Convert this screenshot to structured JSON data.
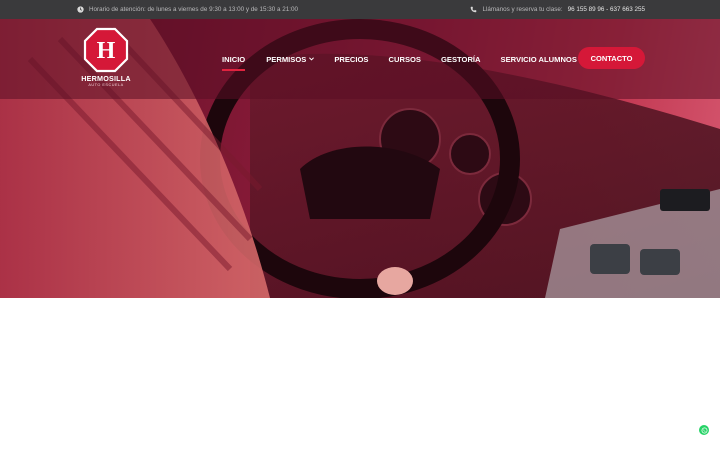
{
  "topbar": {
    "hours": "Horario de atención: de lunes a viernes de 9:30 a 13:00 y de 15:30 a 21:00",
    "call_prefix": "Llámanos y reserva tu clase:",
    "phones": "96 155 89 96 - 637 663 255",
    "icons": {
      "hours": "clock-icon",
      "call": "phone-icon"
    }
  },
  "logo": {
    "name": "HERMOSILLA",
    "subtitle": "AUTO ESCUELA",
    "monogram": "H"
  },
  "nav": {
    "items": [
      {
        "label": "INICIO",
        "active": true
      },
      {
        "label": "PERMISOS",
        "has_dropdown": true
      },
      {
        "label": "PRECIOS"
      },
      {
        "label": "CURSOS"
      },
      {
        "label": "GESTORÍA"
      },
      {
        "label": "SERVICIO ALUMNOS"
      }
    ],
    "cta": "CONTACTO"
  },
  "colors": {
    "brand_red": "#d51838",
    "topbar_bg": "#3a3a3c",
    "hero_tint": "#8a1a36",
    "whatsapp": "#25d366"
  },
  "floating": {
    "icon": "whatsapp-icon"
  }
}
